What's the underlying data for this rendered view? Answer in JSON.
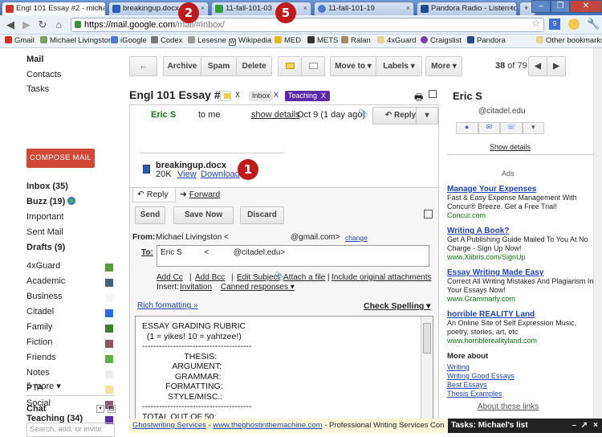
{
  "browser": {
    "tabs": [
      {
        "label": "Engl 101 Essay #2 - micha",
        "icon": "gmail-icon",
        "color": "#d93025"
      },
      {
        "label": "breakingup.docx",
        "icon": "word-icon",
        "color": "#2b5fb4"
      },
      {
        "label": "11-fall-101-03",
        "icon": "spreadsheet-icon",
        "color": "#2f9e3f"
      },
      {
        "label": "11-fall-101-19",
        "icon": "loading-icon",
        "color": "#4a7ad0"
      },
      {
        "label": "Pandora Radio - Listen to",
        "icon": "pandora-icon",
        "color": "#224b8c"
      }
    ],
    "url_host": "https://mail.google.com",
    "url_path": "/mail/#inbox/",
    "bookmarks": [
      "Gmail",
      "Michael Livingston",
      "iGoogle",
      "Codex",
      "Lesesne",
      "Wikipedia",
      "MED",
      "METS",
      "Ralan",
      "4xGuard",
      "Craigslist",
      "Pandora",
      "Other bookmarks"
    ]
  },
  "sidebar": {
    "brand": "Mail",
    "contacts": "Contacts",
    "tasks": "Tasks",
    "compose": "COMPOSE MAIL",
    "items": [
      {
        "label": "Inbox (35)",
        "bold": true
      },
      {
        "label": "Buzz (19)",
        "bold": true
      },
      {
        "label": "Important",
        "bold": false
      },
      {
        "label": "Sent Mail",
        "bold": false
      },
      {
        "label": "Drafts (9)",
        "bold": true
      }
    ],
    "labels": [
      {
        "label": "4xGuard",
        "color": "#5a9e3a",
        "bold": false
      },
      {
        "label": "Academic",
        "color": "#4a5f80",
        "bold": false
      },
      {
        "label": "Business",
        "color": "#f5f5f5",
        "bold": false
      },
      {
        "label": "Citadel",
        "color": "#2a6fe0",
        "bold": false
      },
      {
        "label": "Family",
        "color": "#3f7f2b",
        "bold": false
      },
      {
        "label": "Fiction",
        "color": "#8a5a5a",
        "bold": false
      },
      {
        "label": "Friends",
        "color": "#5fae44",
        "bold": false
      },
      {
        "label": "Notes",
        "color": "#eeeeee",
        "bold": false
      },
      {
        "label": "PTA",
        "color": "#f2e0a0",
        "bold": false
      },
      {
        "label": "Social",
        "color": "#8a5a72",
        "bold": false
      },
      {
        "label": "Teaching (34)",
        "color": "#5b2aa8",
        "bold": true
      }
    ],
    "more": "5 more ▾",
    "chat": "Chat",
    "chat_placeholder": "Search, add, or invite"
  },
  "toolbar": {
    "back": "←",
    "archive": "Archive",
    "spam": "Spam",
    "delete": "Delete",
    "move": "Move to ▾",
    "labels": "Labels ▾",
    "more": "More ▾",
    "pager_pos": "38",
    "pager_of": " of 79"
  },
  "message": {
    "subject": "Engl 101 Essay #2",
    "chips": [
      {
        "label": "Inbox",
        "bg": "#e6e6e6",
        "fg": "#333"
      },
      {
        "label": "Teaching",
        "bg": "#5b2aa8",
        "fg": "#fff"
      }
    ],
    "chip_x": "X",
    "from_name": "Eric S",
    "to": "to me",
    "show_details": "show details",
    "date": "Oct 9 (1 day ago)",
    "reply": "Reply",
    "attachment_name": "breakingup.docx",
    "attachment_size": "20K",
    "view": "View",
    "download": "Download"
  },
  "compose_area": {
    "reply_tab": "Reply",
    "forward_tab": "Forward",
    "send": "Send",
    "save_now": "Save Now",
    "discard": "Discard",
    "from_label": "From:",
    "from_name": "Michael Livingston <",
    "from_domain": "@gmail.com>",
    "change": "change",
    "to_label": "To:",
    "to_value": "Eric S          <           @citadel.edu>",
    "add_cc": "Add Cc",
    "add_bcc": "Add Bcc",
    "edit_subject": "Edit Subject",
    "attach": "Attach a file",
    "include": "Include original attachments",
    "insert": "Insert:",
    "invitation": "Invitation",
    "canned": "Canned responses ▾",
    "rich": "Rich formatting »",
    "spell": "Check Spelling ▾",
    "body": "ESSAY GRADING RUBRIC\n  (1 = yikes! 10 = yahtzee!)\n---------------------------------------\n                  THESIS:\n             ARGUMENT:\n              GRAMMAR:\n          FORMATTING:\n           STYLE/MISC.:\n---------------------------------------\nTOTAL OUT OF 50:"
  },
  "callouts": [
    "1",
    "2",
    "3",
    "4",
    "5"
  ],
  "contact": {
    "name": "Eric S",
    "email": "@citadel.edu",
    "show_details": "Show details"
  },
  "ads": {
    "heading": "Ads",
    "items": [
      {
        "title": "Manage Your Expenses",
        "desc": "Fast & Easy Expense Management With Concur® Breeze. Get a Free Trial!",
        "url": "Concur.com"
      },
      {
        "title": "Writing A Book?",
        "desc": "Get A Publishing Guide Mailed To You At No Charge - Sign Up Now!",
        "url": "www.Xlibris.com/SignUp"
      },
      {
        "title": "Essay Writing Made Easy",
        "desc": "Correct All Writing Mistakes And Plagiarism In Your Essays Now!",
        "url": "www.Grammarly.com"
      },
      {
        "title": "horrible REALITY Land",
        "desc": "An Online Site of Self Expression Music, poetry, stories, art, etc",
        "url": "www.horriblerealityland.com"
      }
    ],
    "more_about": "More about",
    "links": [
      "Writing",
      "Writing Good Essays",
      "Best Essays",
      "Thesis Examples"
    ],
    "about": "About these links"
  },
  "footer": {
    "link1": "Ghostwriting Services",
    "sep": " - ",
    "link2": "www.theghostinthemachine.com",
    "text": " - Professional Writing Services Con"
  },
  "tasks_bar": "Tasks: Michael's list"
}
